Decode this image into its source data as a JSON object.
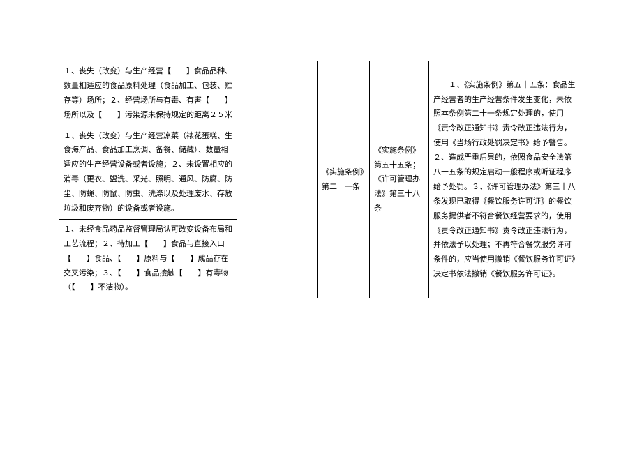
{
  "table": {
    "col1_row1": "１、丧失（改变）与生产经营【　　】食品品种、数量相适应的食品原料处理（食品加工、包装、贮存等）场所；２、经营场所与有毒、有害【　　】场所以及【　　】污染源未保持规定的距离２５米",
    "col1_row2": "１、丧失（改变）与生产经营凉菜（裱花蛋糕、生食海产品、食品加工烹调、备餐、储藏）、数量相适应的生产经营设备或者设施；２、未设置相应的消毒（更衣、盥洗、采光、照明、通风、防腐、防尘、防蝇、防鼠、防虫、洗涤以及处理废水、存放垃圾和废弃物）的设备或者设施。",
    "col1_row3": "１、未经食品药品监督管理局认可改变设备布局和工艺流程；２、待加工【　　】食品与直接入口【　　】食品、【　　】原料与【　　】成品存在交叉污染；３、【　　】食品接触【　　】有毒物（【　　】不洁物）。",
    "col2": "",
    "col3": "《实施条例》第二十一条",
    "col4": "《实施条例》第五十五条；《许可管理办法》第三十八条",
    "col5": "　　１、《实施条例》第五十五条：食品生产经营者的生产经营条件发生变化，未依照本条例第二十一条规定处理的，使用《责令改正通知书》责令改正违法行为，使用《当场行政处罚决定书》给予警告。２、造成严重后果的，依照食品安全法第八十五条的规定启动一般程序或听证程序给予处罚。３、《许可管理办法》第三十八条发现已取得《餐饮服务许可证》的餐饮服务提供者不符合餐饮经营要求的，使用《责令改正通知书》责令改正违法行为，并依法予以处理；不再符合餐饮服务许可条件的，应当使用撤销《餐饮服务许可证》决定书依法撤销《餐饮服务许可证》。"
  }
}
